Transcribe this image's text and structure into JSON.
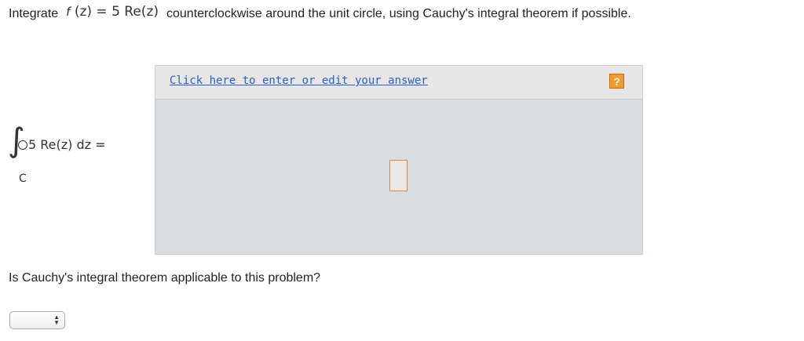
{
  "question1": {
    "prefix": "Integrate",
    "function_lhs": "f",
    "function_rhs": "(z) = 5 Re(z)",
    "suffix": "counterclockwise around the unit circle, using Cauchy's integral theorem if possible."
  },
  "integral": {
    "expression": "5 Re(z) dz =",
    "contour": "C"
  },
  "answer": {
    "link_text": "Click here to enter or edit your answer",
    "help_label": "?"
  },
  "question2": {
    "text": "Is Cauchy's integral theorem applicable to this problem?"
  },
  "dropdown": {
    "selected": "",
    "arrow_up": "▲",
    "arrow_down": "▼"
  },
  "icons": {
    "help": "question-mark-icon",
    "select_arrows": "updown-arrows-icon"
  },
  "colors": {
    "link": "#2a5fc7",
    "help_button": "#f29b2a",
    "answer_input_border": "#e0824a",
    "answer_area": "#d9dcdf"
  }
}
